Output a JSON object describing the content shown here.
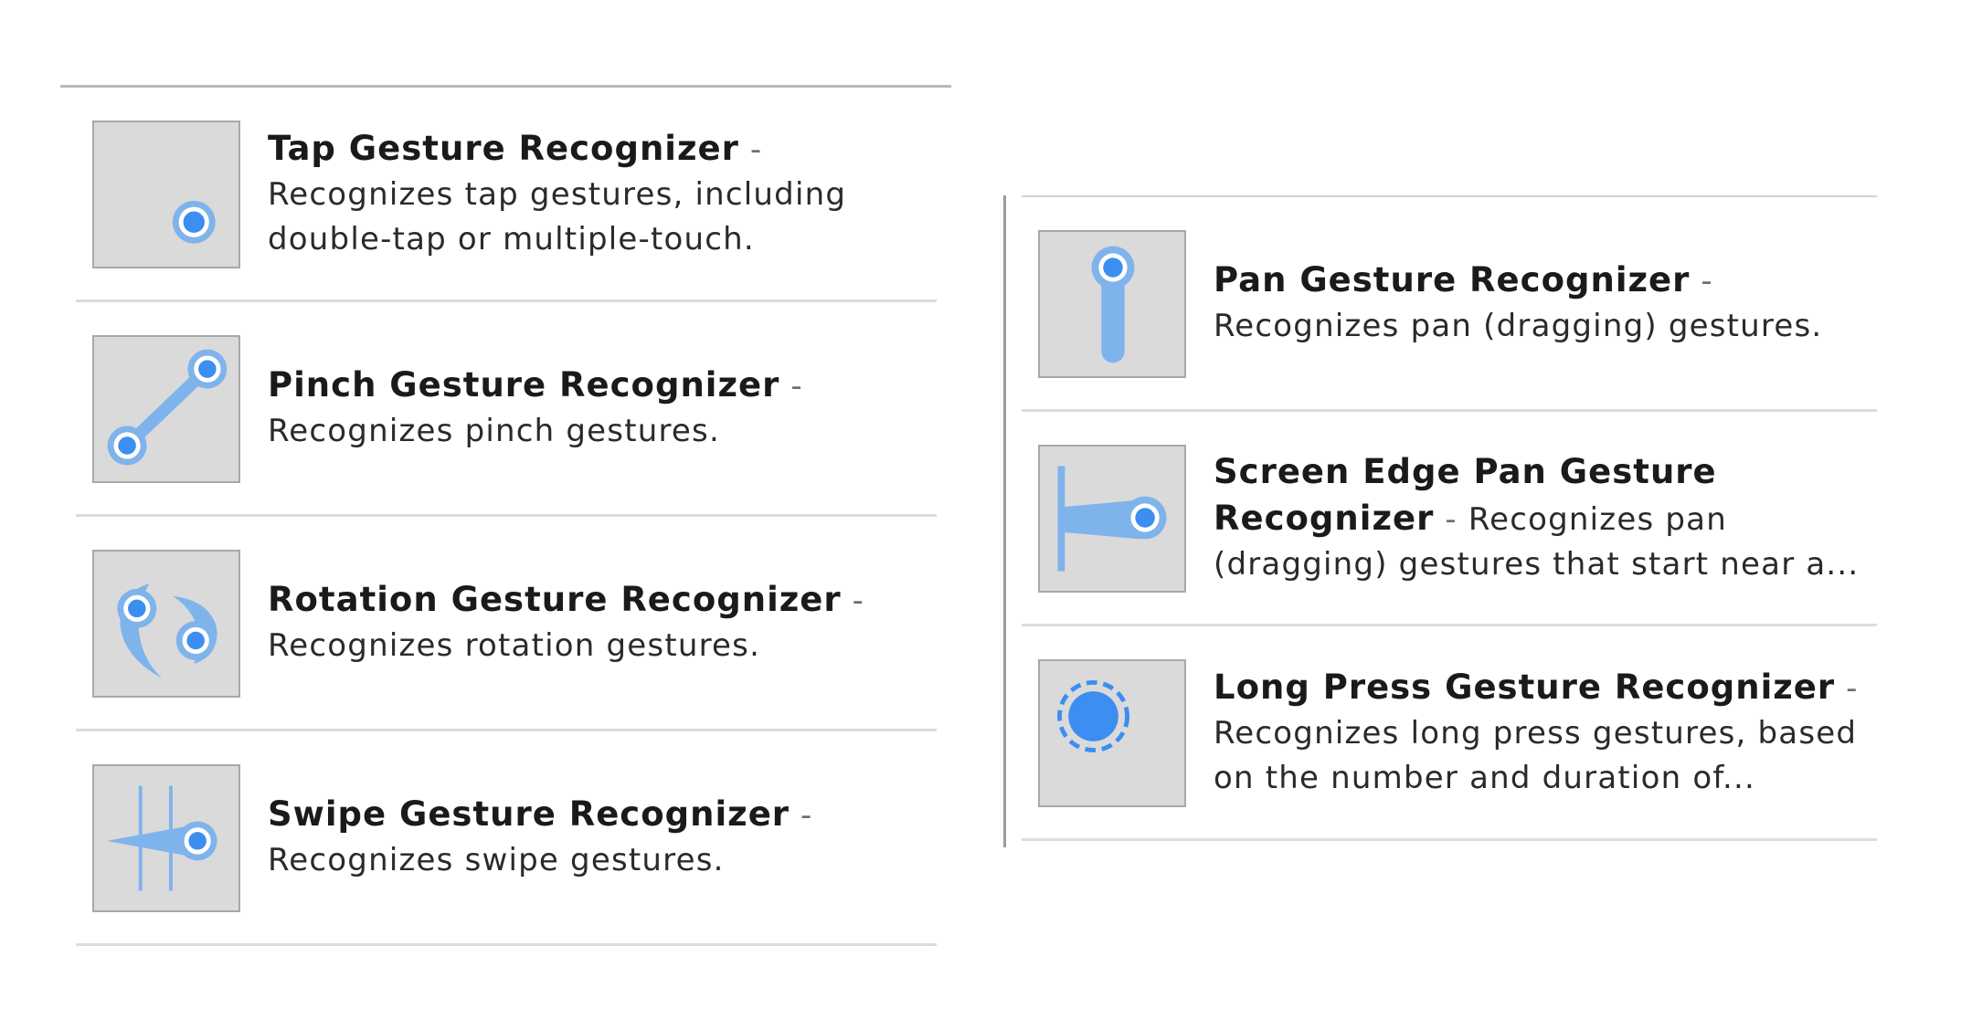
{
  "left_items": [
    {
      "title": "Tap Gesture Recognizer",
      "separator": " - ",
      "description": "Recognizes tap gestures, including double-tap or multiple-touch.",
      "icon": "tap-gesture-icon"
    },
    {
      "title": "Pinch Gesture Recognizer",
      "separator": " - ",
      "description": "Recognizes pinch gestures.",
      "icon": "pinch-gesture-icon"
    },
    {
      "title": "Rotation Gesture Recognizer",
      "separator": " - ",
      "description": "Recognizes rotation gestures.",
      "icon": "rotation-gesture-icon"
    },
    {
      "title": "Swipe Gesture Recognizer",
      "separator": " - ",
      "description": "Recognizes swipe gestures.",
      "icon": "swipe-gesture-icon"
    }
  ],
  "right_items": [
    {
      "title": "Pan Gesture Recognizer",
      "separator": " - ",
      "description": "Recognizes pan (dragging) gestures.",
      "icon": "pan-gesture-icon"
    },
    {
      "title": "Screen Edge Pan Gesture Recognizer",
      "separator": " - ",
      "description": "Recognizes pan (dragging) gestures that start near a...",
      "icon": "screen-edge-pan-gesture-icon"
    },
    {
      "title": "Long Press Gesture Recognizer",
      "separator": " - ",
      "description": "Recognizes long press gestures, based on the number and duration of...",
      "icon": "long-press-gesture-icon"
    }
  ],
  "colors": {
    "accent": "#3c8ef0",
    "accent_light": "#7fb3ec",
    "thumb_background": "#dadada",
    "thumb_border": "#a8a8a8",
    "divider": "#dcdcdc"
  }
}
